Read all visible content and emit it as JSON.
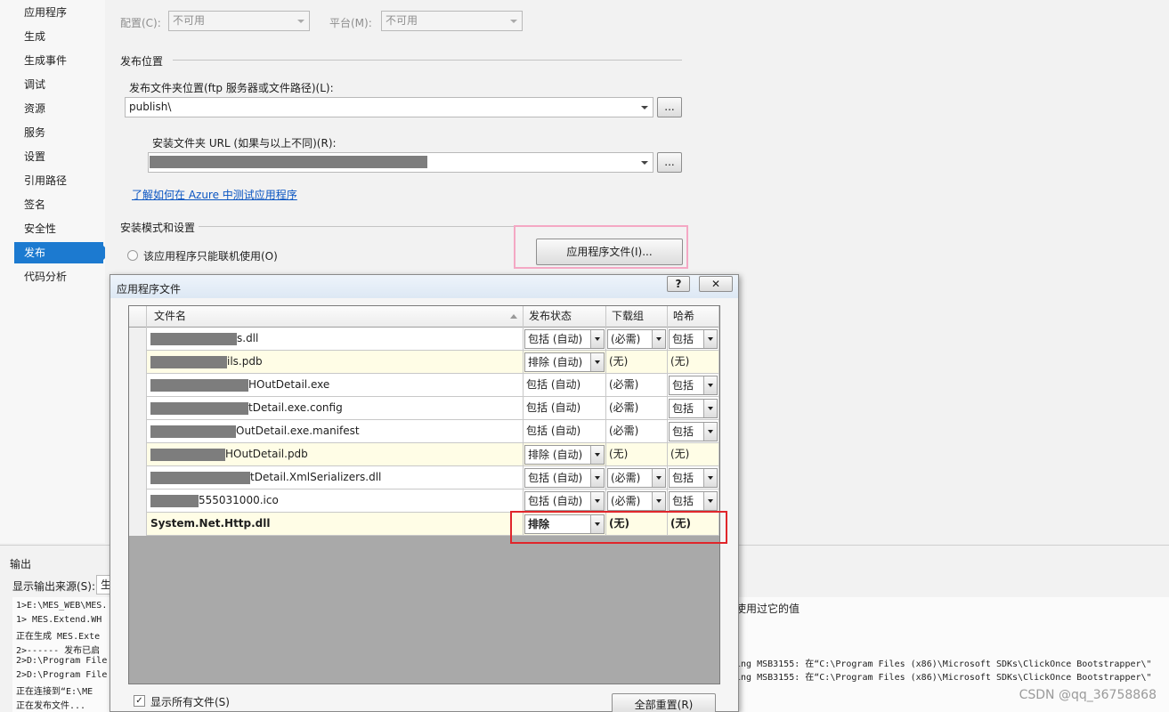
{
  "sidebar": {
    "items": [
      {
        "label": "应用程序"
      },
      {
        "label": "生成"
      },
      {
        "label": "生成事件"
      },
      {
        "label": "调试"
      },
      {
        "label": "资源"
      },
      {
        "label": "服务"
      },
      {
        "label": "设置"
      },
      {
        "label": "引用路径"
      },
      {
        "label": "签名"
      },
      {
        "label": "安全性"
      },
      {
        "label": "发布"
      },
      {
        "label": "代码分析"
      }
    ],
    "active_label": "发布"
  },
  "top": {
    "config_label": "配置(C):",
    "config_value": "不可用",
    "platform_label": "平台(M):",
    "platform_value": "不可用"
  },
  "publish": {
    "section_title": "发布位置",
    "folder_label": "发布文件夹位置(ftp 服务器或文件路径)(L):",
    "folder_value": "publish\\",
    "browse_label": "...",
    "url_label": "安装文件夹 URL (如果与以上不同)(R):",
    "url_value": "",
    "azure_link": "了解如何在 Azure 中测试应用程序"
  },
  "install": {
    "section_title": "安装模式和设置",
    "online_only_label": "该应用程序只能联机使用(O)",
    "app_files_button": "应用程序文件(I)..."
  },
  "output": {
    "title": "输出",
    "source_label": "显示输出来源(S):",
    "source_value": "生",
    "lines_left": [
      "1>E:\\MES_WEB\\MES.",
      "1>  MES.Extend.WH",
      "正在生成 MES.Exte",
      "2>------ 发布已启",
      "2>D:\\Program File",
      "2>D:\\Program File",
      "正在连接到“E:\\ME",
      "正在发布文件..."
    ],
    "right_text_1": "使用过它的值",
    "right_text_2": "ing MSB3155: 在“C:\\Program Files (x86)\\Microsoft SDKs\\ClickOnce Bootstrapper\\\"",
    "right_text_3": "ing MSB3155: 在“C:\\Program Files (x86)\\Microsoft SDKs\\ClickOnce Bootstrapper\\\""
  },
  "watermark": "CSDN @qq_36758868",
  "dialog": {
    "title": "应用程序文件",
    "help_label": "?",
    "close_label": "✕",
    "columns": {
      "file": "文件名",
      "status": "发布状态",
      "group": "下载组",
      "hash": "哈希"
    },
    "rows": [
      {
        "file": "s.dll",
        "status": "包括 (自动)",
        "status_dd": true,
        "group": "(必需)",
        "group_dd": true,
        "hash": "包括",
        "hash_dd": true,
        "yellow": false,
        "bold": false
      },
      {
        "file": "ils.pdb",
        "status": "排除 (自动)",
        "status_dd": true,
        "group": "(无)",
        "group_dd": false,
        "hash": "(无)",
        "hash_dd": false,
        "yellow": true,
        "bold": false
      },
      {
        "file": "HOutDetail.exe",
        "status": "包括 (自动)",
        "status_dd": false,
        "group": "(必需)",
        "group_dd": false,
        "hash": "包括",
        "hash_dd": true,
        "yellow": false,
        "bold": false
      },
      {
        "file": "tDetail.exe.config",
        "status": "包括 (自动)",
        "status_dd": false,
        "group": "(必需)",
        "group_dd": false,
        "hash": "包括",
        "hash_dd": true,
        "yellow": false,
        "bold": false
      },
      {
        "file": "OutDetail.exe.manifest",
        "status": "包括 (自动)",
        "status_dd": false,
        "group": "(必需)",
        "group_dd": false,
        "hash": "包括",
        "hash_dd": true,
        "yellow": false,
        "bold": false
      },
      {
        "file": "HOutDetail.pdb",
        "status": "排除 (自动)",
        "status_dd": true,
        "group": "(无)",
        "group_dd": false,
        "hash": "(无)",
        "hash_dd": false,
        "yellow": true,
        "bold": false
      },
      {
        "file": "tDetail.XmlSerializers.dll",
        "status": "包括 (自动)",
        "status_dd": true,
        "group": "(必需)",
        "group_dd": true,
        "hash": "包括",
        "hash_dd": true,
        "yellow": false,
        "bold": false
      },
      {
        "file": "555031000.ico",
        "status": "包括 (自动)",
        "status_dd": true,
        "group": "(必需)",
        "group_dd": true,
        "hash": "包括",
        "hash_dd": true,
        "yellow": false,
        "bold": false
      },
      {
        "file": "System.Net.Http.dll",
        "status": "排除",
        "status_dd": true,
        "group": "(无)",
        "group_dd": false,
        "hash": "(无)",
        "hash_dd": false,
        "yellow": true,
        "bold": true
      }
    ],
    "show_all_label": "显示所有文件(S)",
    "reset_button": "全部重置(R)"
  },
  "colors": {
    "accent": "#1c7ad0",
    "highlight_red": "#e0262b",
    "highlight_pink": "#f4a8c4",
    "row_yellow": "#fffde6",
    "link": "#0a55c2"
  }
}
